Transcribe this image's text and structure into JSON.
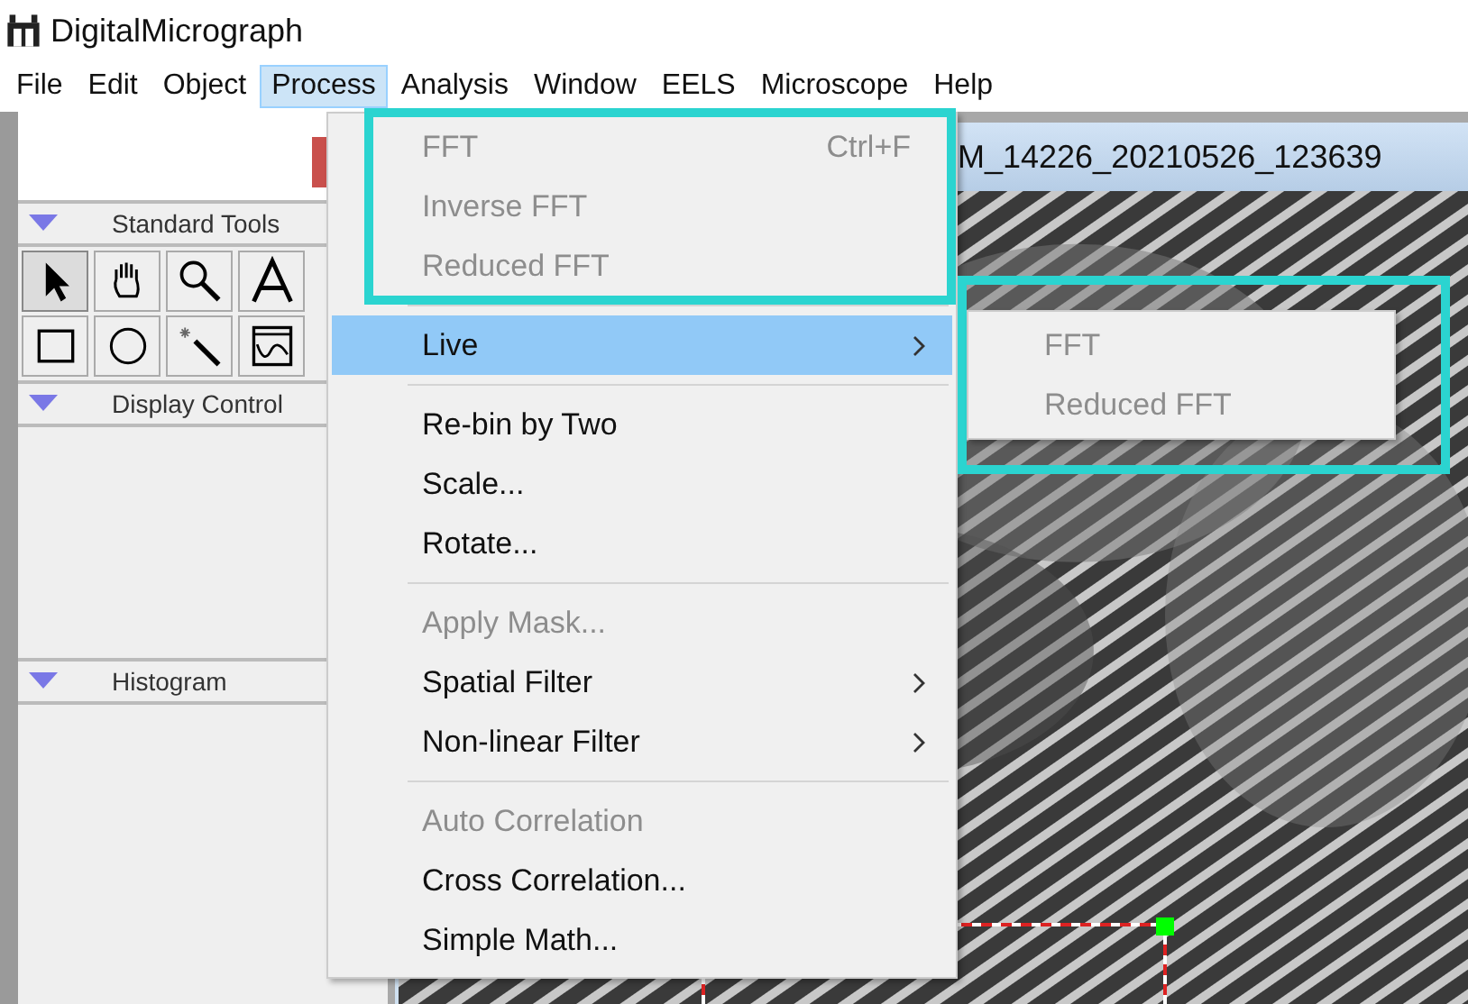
{
  "window": {
    "title": "DigitalMicrograph"
  },
  "menubar": [
    {
      "label": "File",
      "selected": false
    },
    {
      "label": "Edit",
      "selected": false
    },
    {
      "label": "Object",
      "selected": false
    },
    {
      "label": "Process",
      "selected": true
    },
    {
      "label": "Analysis",
      "selected": false
    },
    {
      "label": "Window",
      "selected": false
    },
    {
      "label": "EELS",
      "selected": false
    },
    {
      "label": "Microscope",
      "selected": false
    },
    {
      "label": "Help",
      "selected": false
    }
  ],
  "panels": [
    {
      "title": "Standard Tools",
      "tools": [
        {
          "kind": "pointer",
          "selected": true
        },
        {
          "kind": "hand",
          "selected": false
        },
        {
          "kind": "zoom",
          "selected": false
        },
        {
          "kind": "text",
          "selected": false
        },
        {
          "kind": "rect",
          "selected": false
        },
        {
          "kind": "oval",
          "selected": false
        },
        {
          "kind": "wand",
          "selected": false
        },
        {
          "kind": "profile",
          "selected": false
        }
      ]
    },
    {
      "title": "Display Control"
    },
    {
      "title": "Histogram"
    }
  ],
  "image_window": {
    "title": "M_14226_20210526_123639"
  },
  "process_menu": [
    {
      "highlighted": true,
      "items": [
        {
          "label": "FFT",
          "shortcut": "Ctrl+F",
          "disabled": true,
          "selected": false,
          "submenu": false
        },
        {
          "label": "Inverse FFT",
          "disabled": true,
          "selected": false,
          "submenu": false
        },
        {
          "label": "Reduced FFT",
          "disabled": true,
          "selected": false,
          "submenu": false
        }
      ]
    },
    {
      "highlighted": false,
      "items": [
        {
          "label": "Live",
          "disabled": false,
          "selected": true,
          "submenu": true
        }
      ]
    },
    {
      "highlighted": false,
      "items": [
        {
          "label": "Re-bin by Two",
          "disabled": false,
          "selected": false,
          "submenu": false
        },
        {
          "label": "Scale...",
          "disabled": false,
          "selected": false,
          "submenu": false
        },
        {
          "label": "Rotate...",
          "disabled": false,
          "selected": false,
          "submenu": false
        }
      ]
    },
    {
      "highlighted": false,
      "items": [
        {
          "label": "Apply Mask...",
          "disabled": true,
          "selected": false,
          "submenu": false
        },
        {
          "label": "Spatial Filter",
          "disabled": false,
          "selected": false,
          "submenu": true
        },
        {
          "label": "Non-linear Filter",
          "disabled": false,
          "selected": false,
          "submenu": true
        }
      ]
    },
    {
      "highlighted": false,
      "items": [
        {
          "label": "Auto Correlation",
          "disabled": true,
          "selected": false,
          "submenu": false
        },
        {
          "label": "Cross Correlation...",
          "disabled": false,
          "selected": false,
          "submenu": false
        },
        {
          "label": "Simple Math...",
          "disabled": false,
          "selected": false,
          "submenu": false
        }
      ]
    }
  ],
  "live_submenu": {
    "highlighted": true,
    "items": [
      {
        "label": "FFT",
        "disabled": true
      },
      {
        "label": "Reduced FFT",
        "disabled": true
      }
    ]
  }
}
